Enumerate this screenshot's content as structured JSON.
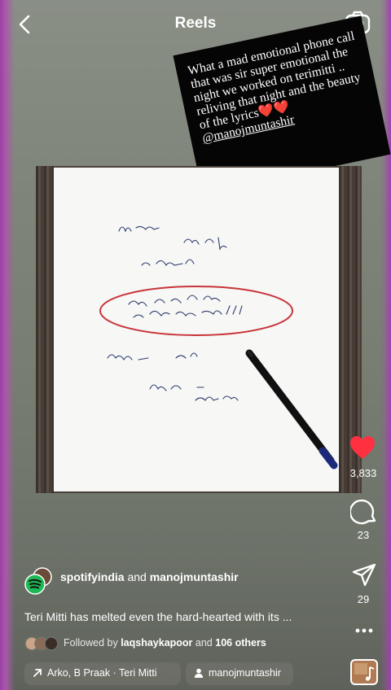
{
  "header": {
    "title": "Reels"
  },
  "caption_overlay": {
    "text": "What a mad emotional phone call that was sir super emotional the night we worked on terimitti .. reliving that night and the beauty of the lyrics",
    "hearts": "❤️❤️",
    "mention": "@manojmuntashir"
  },
  "actions": {
    "likes": "3,833",
    "comments": "23",
    "shares": "29"
  },
  "post": {
    "author_primary": "spotifyindia",
    "author_joiner": "and",
    "author_secondary": "manojmuntashir",
    "description": "Teri Mitti has melted even the hard-hearted with its ...",
    "followed_prefix": "Followed by",
    "followed_user": "laqshaykapoor",
    "followed_joiner": "and",
    "followed_others": "106 others"
  },
  "audio": {
    "track": "Arko, B Praak · Teri Mitti",
    "user_tag": "manojmuntashir"
  },
  "colors": {
    "like_red": "#ff3040",
    "spotify_green": "#1db954",
    "gradient_purple": "#9d44a9"
  },
  "icons": [
    "back-arrow-icon",
    "camera-icon",
    "heart-icon",
    "comment-icon",
    "share-icon",
    "more-icon",
    "music-arrow-icon",
    "person-icon",
    "audio-thumbnail"
  ]
}
